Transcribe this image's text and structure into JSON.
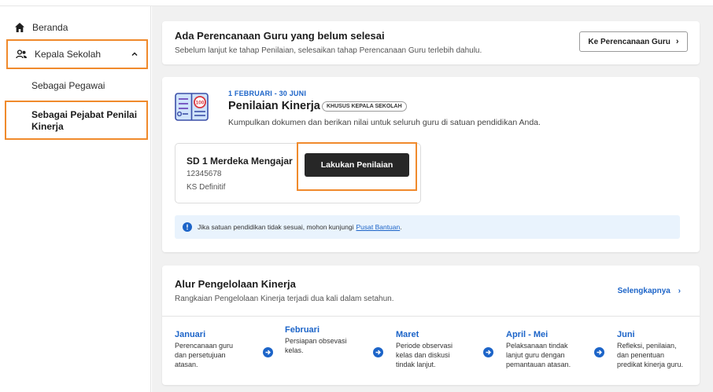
{
  "sidebar": {
    "beranda": "Beranda",
    "kepala_sekolah": "Kepala Sekolah",
    "sub_items": [
      "Sebagai Pegawai",
      "Sebagai Pejabat Penilai Kinerja"
    ]
  },
  "banner": {
    "title": "Ada Perencanaan Guru yang belum selesai",
    "subtitle": "Sebelum lanjut ke tahap Penilaian, selesaikan tahap Perencanaan Guru terlebih dahulu.",
    "button_label": "Ke Perencanaan Guru"
  },
  "penilaian": {
    "date_range": "1 FEBRUARI - 30 JUNI",
    "title": "Penilaian Kinerja",
    "badge": "KHUSUS KEPALA SEKOLAH",
    "description": "Kumpulkan dokumen dan berikan nilai untuk seluruh guru di satuan pendidikan Anda.",
    "school_name": "SD 1 Merdeka Mengajar",
    "school_code": "12345678",
    "school_status": "KS Definitif",
    "button_label": "Lakukan Penilaian",
    "info_text": "Jika satuan pendidikan tidak sesuai, mohon kunjungi",
    "info_link": "Pusat Bantuan",
    "info_end": "."
  },
  "alur": {
    "title": "Alur Pengelolaan Kinerja",
    "subtitle": "Rangkaian Pengelolaan Kinerja terjadi dua kali dalam setahun.",
    "link_label": "Selengkapnya",
    "steps": [
      {
        "month": "Januari",
        "lines": [
          "Perencanaan guru",
          "dan persetujuan",
          "atasan."
        ]
      },
      {
        "month": "Februari",
        "lines": [
          "Persiapan obsevasi",
          "kelas."
        ]
      },
      {
        "month": "Maret",
        "lines": [
          "Periode observasi",
          "kelas dan diskusi",
          "tindak lanjut."
        ]
      },
      {
        "month": "April - Mei",
        "lines": [
          "Pelaksanaan tindak",
          "lanjut guru dengan",
          "pemantauan atasan."
        ]
      },
      {
        "month": "Juni",
        "lines": [
          "Refleksi, penilaian,",
          "dan penentuan",
          "predikat kinerja guru."
        ]
      }
    ]
  },
  "colors": {
    "accent_blue": "#1c64c8",
    "highlight_orange": "#f08a2c",
    "dark_button": "#272727",
    "info_bg": "#e9f3fd"
  }
}
